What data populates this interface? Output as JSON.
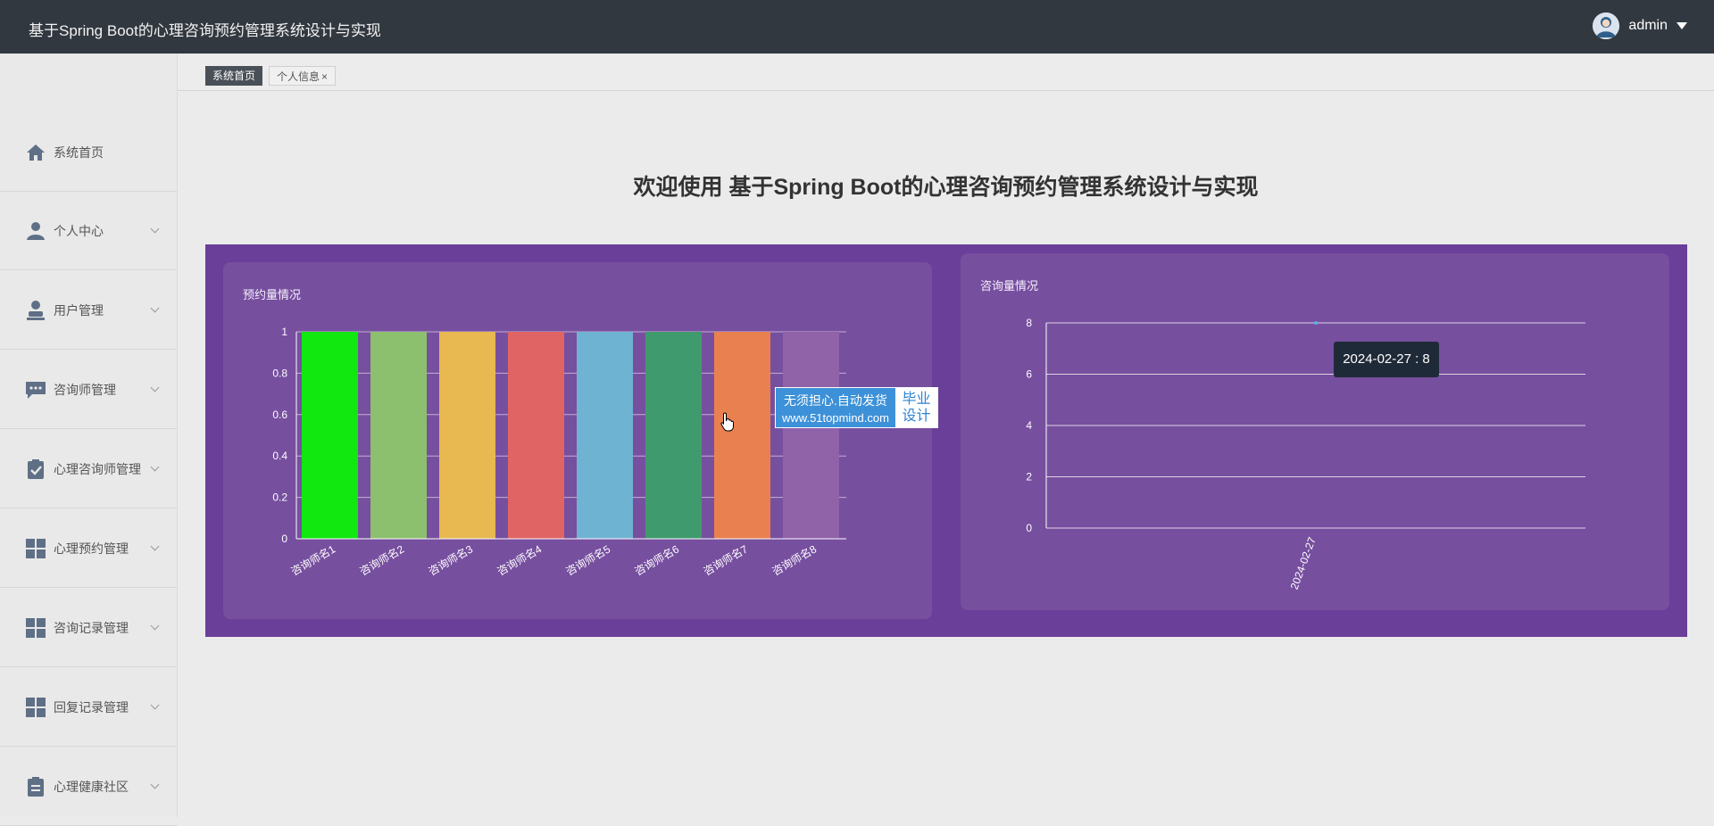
{
  "header": {
    "title": "基于Spring Boot的心理咨询预约管理系统设计与实现",
    "username": "admin"
  },
  "tabs": [
    {
      "label": "系统首页"
    },
    {
      "label": "个人信息"
    }
  ],
  "sidebar": {
    "items": [
      {
        "label": "系统首页",
        "icon": "home-icon"
      },
      {
        "label": "个人中心",
        "icon": "person-icon"
      },
      {
        "label": "用户管理",
        "icon": "user-manage-icon"
      },
      {
        "label": "咨询师管理",
        "icon": "chat-icon"
      },
      {
        "label": "心理咨询师管理",
        "icon": "clipboard-check-icon"
      },
      {
        "label": "心理预约管理",
        "icon": "grid-icon"
      },
      {
        "label": "咨询记录管理",
        "icon": "grid-icon"
      },
      {
        "label": "回复记录管理",
        "icon": "grid-icon"
      },
      {
        "label": "心理健康社区",
        "icon": "clipboard-icon"
      }
    ]
  },
  "welcome": "欢迎使用 基于Spring Boot的心理咨询预约管理系统设计与实现",
  "watermark": {
    "line1": "无须担心.自动发货",
    "line2": "www.51topmind.com",
    "badge1": "毕业",
    "badge2": "设计"
  },
  "tooltip": "2024-02-27 : 8",
  "chart_data": [
    {
      "type": "bar",
      "title": "预约量情况",
      "categories": [
        "咨询师名1",
        "咨询师名2",
        "咨询师名3",
        "咨询师名4",
        "咨询师名5",
        "咨询师名6",
        "咨询师名7",
        "咨询师名8"
      ],
      "values": [
        1,
        1,
        1,
        1,
        1,
        1,
        1,
        1
      ],
      "colors": [
        "#10e810",
        "#8cbf6e",
        "#e8b851",
        "#e06464",
        "#6fb3d2",
        "#3f9b6d",
        "#e9804f",
        "#9062a8"
      ],
      "ylim": [
        0,
        1
      ],
      "yticks": [
        "0",
        "0.2",
        "0.4",
        "0.6",
        "0.8",
        "1"
      ],
      "grid": true
    },
    {
      "type": "line",
      "title": "咨询量情况",
      "x": [
        "2024-02-27"
      ],
      "values": [
        8
      ],
      "ylim": [
        0,
        8
      ],
      "yticks": [
        "0",
        "2",
        "4",
        "6",
        "8"
      ],
      "grid": true
    }
  ]
}
